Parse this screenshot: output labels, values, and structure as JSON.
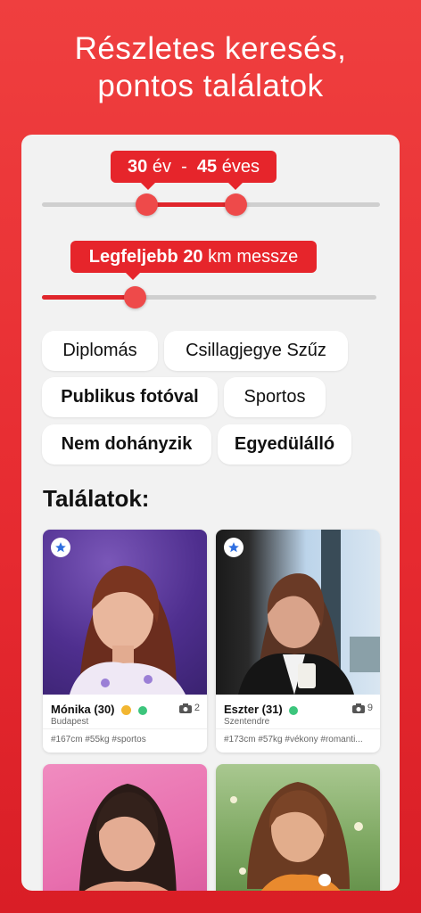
{
  "headline": {
    "line1": "Részletes keresés,",
    "line2": "pontos találatok"
  },
  "age_filter": {
    "min": "30",
    "min_unit": "év",
    "separator": "-",
    "max": "45",
    "max_unit": "éves",
    "range_min_fraction": 0.32,
    "range_max_fraction": 0.57
  },
  "distance_filter": {
    "prefix": "Legfeljebb",
    "value": "20",
    "unit": "km messze",
    "fraction": 0.27
  },
  "chips": [
    {
      "label": "Diplomás",
      "selected": false
    },
    {
      "label": "Csillagjegye Szűz",
      "selected": false
    },
    {
      "label": "Publikus fotóval",
      "selected": true
    },
    {
      "label": "Sportos",
      "selected": false
    },
    {
      "label": "Nem dohányzik",
      "selected": true
    },
    {
      "label": "Egyedülálló",
      "selected": true
    }
  ],
  "results": {
    "title": "Találatok:",
    "profiles": [
      {
        "name": "Mónika (30)",
        "city": "Budapest",
        "photos": "2",
        "tags": "#167cm #55kg #sportos",
        "verified": true,
        "online": true
      },
      {
        "name": "Eszter (31)",
        "city": "Szentendre",
        "photos": "9",
        "tags": "#173cm #57kg #vékony #romanti...",
        "verified": false,
        "online": true
      },
      {
        "name": "",
        "city": "",
        "photos": "",
        "tags": ""
      },
      {
        "name": "",
        "city": "",
        "photos": "",
        "tags": ""
      }
    ]
  },
  "colors": {
    "brand_red": "#e6252b",
    "online_green": "#3cc57c",
    "verified_gold": "#f2b631",
    "star_blue": "#2f6fe0"
  }
}
